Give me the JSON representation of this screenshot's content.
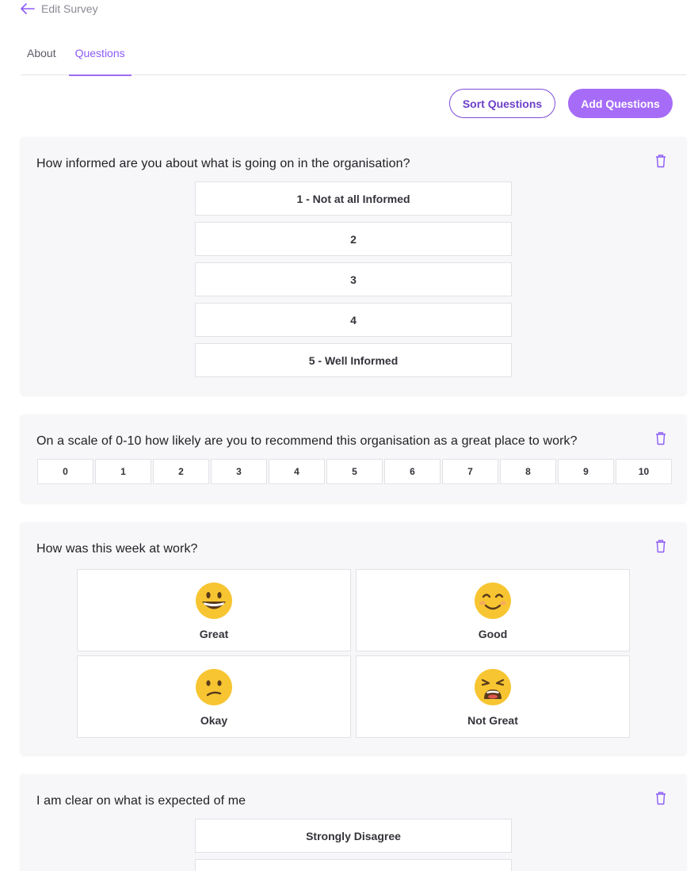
{
  "header": {
    "back_label": "Edit Survey"
  },
  "tabs": [
    {
      "label": "About",
      "active": false
    },
    {
      "label": "Questions",
      "active": true
    }
  ],
  "toolbar": {
    "sort_label": "Sort Questions",
    "add_label": "Add Questions"
  },
  "colors": {
    "accent": "#a66cf7",
    "accent_dark": "#6d3fc9",
    "card_bg": "#f7f7f9"
  },
  "questions": [
    {
      "title": "How informed are you about what is going on in the organisation?",
      "options": [
        "1 - Not at all Informed",
        "2",
        "3",
        "4",
        "5 - Well Informed"
      ]
    },
    {
      "title": "On a scale of 0-10 how likely are you to recommend this organisation as a great place to work?",
      "scale": [
        "0",
        "1",
        "2",
        "3",
        "4",
        "5",
        "6",
        "7",
        "8",
        "9",
        "10"
      ]
    },
    {
      "title": "How was this week at work?",
      "moods": [
        {
          "label": "Great",
          "icon": "grinning-face-icon"
        },
        {
          "label": "Good",
          "icon": "smiling-face-icon"
        },
        {
          "label": "Okay",
          "icon": "confused-face-icon"
        },
        {
          "label": "Not Great",
          "icon": "weary-face-icon"
        }
      ]
    },
    {
      "title": "I am clear on what is expected of me",
      "options": [
        "Strongly Disagree"
      ]
    }
  ]
}
